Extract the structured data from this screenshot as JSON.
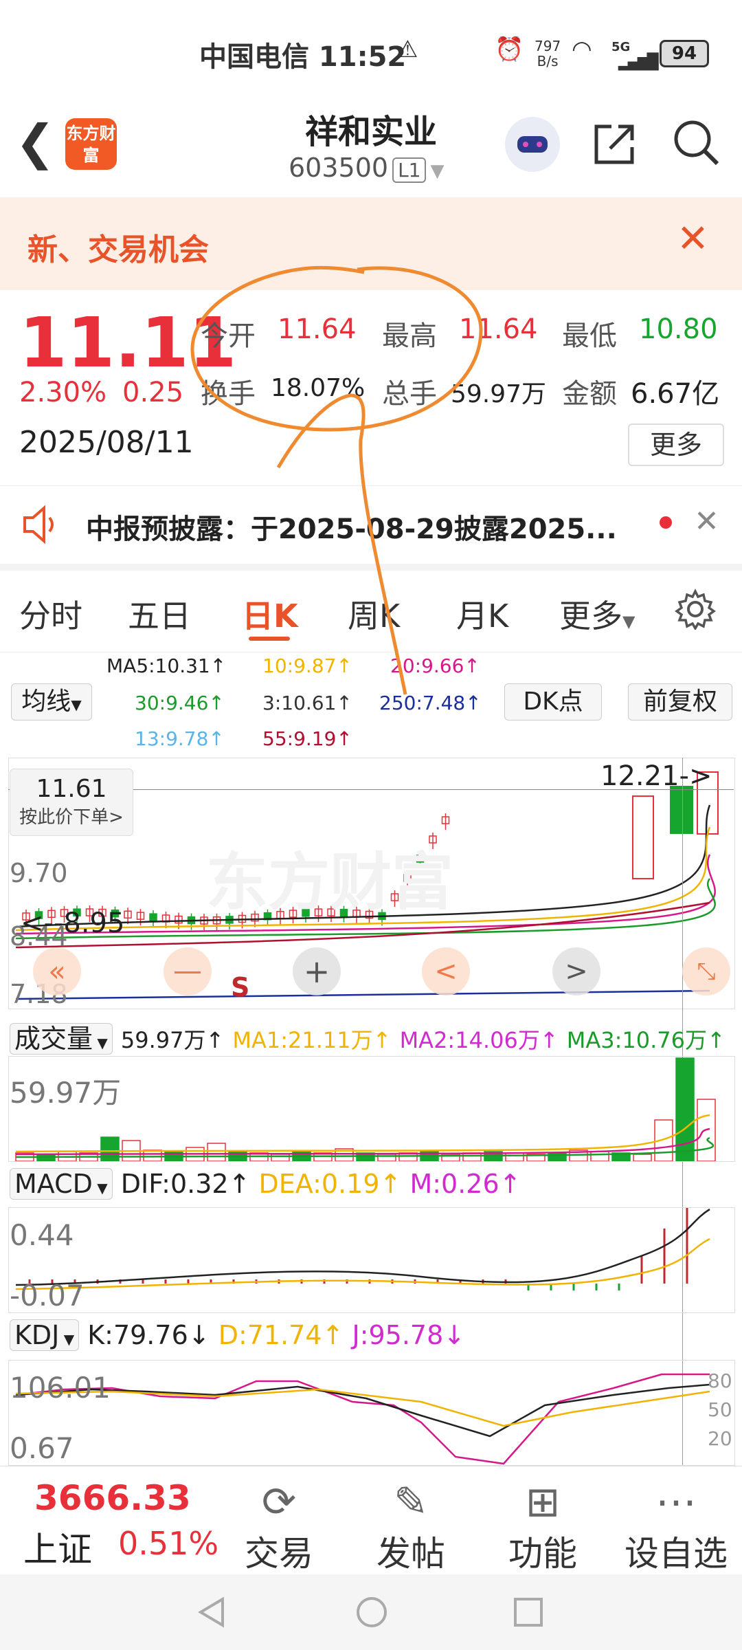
{
  "status_bar": {
    "carrier": "中国电信 11:52",
    "net_speed_top": "797",
    "net_speed_unit": "B/s",
    "network": "5G",
    "battery": "94"
  },
  "header": {
    "logo_text": "东方财富",
    "title": "祥和实业",
    "code": "603500",
    "level_badge": "L1"
  },
  "banner": {
    "text": "新、交易机会"
  },
  "quote": {
    "price": "11.11",
    "change_pct": "2.30%",
    "change": "0.25",
    "date": "2025/08/11",
    "open_label": "今开",
    "open": "11.64",
    "high_label": "最高",
    "high": "11.64",
    "low_label": "最低",
    "low": "10.80",
    "turnover_label": "换手",
    "turnover": "18.07%",
    "volume_label": "总手",
    "volume": "59.97万",
    "amount_label": "金额",
    "amount": "6.67亿",
    "more_label": "更多"
  },
  "notice": {
    "text": "中报预披露：于2025-08-29披露2025..."
  },
  "tabs": [
    "分时",
    "五日",
    "日K",
    "周K",
    "月K",
    "更多"
  ],
  "ma_legend": {
    "ma5": "MA5:10.31↑",
    "ma10": "10:9.87↑",
    "ma20": "20:9.66↑",
    "ma30": "30:9.46↑",
    "ma3": "3:10.61↑",
    "ma250": "250:7.48↑",
    "ma13": "13:9.78↑",
    "ma55": "55:9.19↑",
    "selector": "均线",
    "dk_button": "DK点",
    "fq_button": "前复权"
  },
  "kline": {
    "crosshair_price": "11.61",
    "order_hint": "按此价下单",
    "high_marker": "12.21->",
    "low_marker": "<--8.95",
    "axis_labels": [
      "9.70",
      "8.44",
      "7.18"
    ],
    "s_marker": "S",
    "watermark": "东方财富"
  },
  "volume": {
    "selector": "成交量",
    "value": "59.97万↑",
    "ma1": "MA1:21.11万↑",
    "ma2": "MA2:14.06万↑",
    "ma3": "MA3:10.76万↑",
    "axis_label": "59.97万"
  },
  "macd": {
    "selector": "MACD",
    "dif": "DIF:0.32↑",
    "dea": "DEA:0.19↑",
    "m": "M:0.26↑",
    "axis_top": "0.44",
    "axis_bottom": "-0.07"
  },
  "kdj": {
    "selector": "KDJ",
    "k": "K:79.76↓",
    "d": "D:71.74↑",
    "j": "J:95.78↓",
    "axis_top": "106.01",
    "axis_bottom": "0.67",
    "ticks": [
      "80",
      "50",
      "20"
    ]
  },
  "bottom_bar": {
    "index_value": "3666.33",
    "index_name": "上证",
    "index_pct": "0.51%",
    "items": [
      "交易",
      "发帖",
      "功能",
      "设自选"
    ]
  },
  "colors": {
    "up": "#e8303a",
    "down": "#16a52f",
    "accent": "#e8532a",
    "ma5": "#222222",
    "ma10": "#f0b400",
    "ma20": "#d6178a",
    "ma30": "#1a9b2a",
    "ma250": "#1a2f9b",
    "annotation": "#f08a30"
  }
}
